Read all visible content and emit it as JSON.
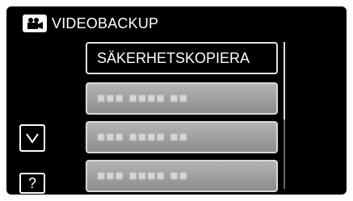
{
  "header": {
    "mode_icon": "video-camera-icon",
    "title": "VIDEOBACKUP"
  },
  "menu": {
    "items": [
      {
        "label": "SÄKERHETSKOPIERA",
        "selected": true
      },
      {
        "label": "■■■ ■■■■ ■■",
        "selected": false
      },
      {
        "label": "■■■ ■■■■ ■■",
        "selected": false
      },
      {
        "label": "■■■ ■■■■ ■■",
        "selected": false
      }
    ]
  },
  "side_buttons": {
    "scroll_down_icon": "chevron-down-icon",
    "help_label": "?"
  },
  "colors": {
    "background": "#000000",
    "button_fill": "#9e9e9e",
    "text": "#ffffff"
  }
}
